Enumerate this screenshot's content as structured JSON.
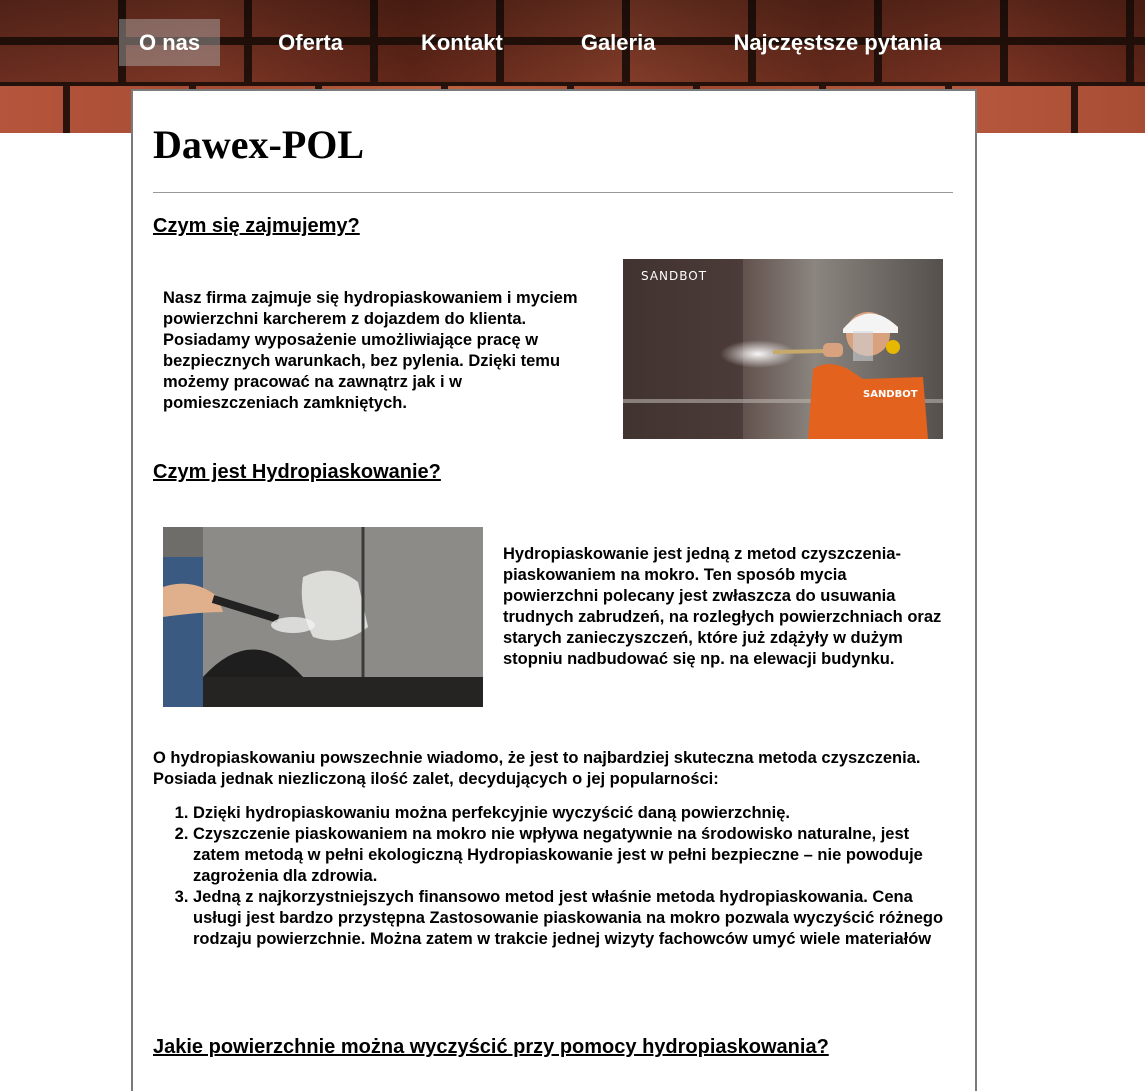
{
  "nav": {
    "items": [
      {
        "label": "O nas",
        "active": true
      },
      {
        "label": "Oferta",
        "active": false
      },
      {
        "label": "Kontakt",
        "active": false
      },
      {
        "label": "Galeria",
        "active": false
      },
      {
        "label": "Najczęstsze pytania",
        "active": false
      }
    ]
  },
  "main": {
    "title": "Dawex-POL",
    "section1": {
      "heading": "Czym się zajmujemy?",
      "text": "Nasz firma zajmuje się hydropiaskowaniem i myciem powierzchni karcherem z dojazdem do klienta. Posiadamy wyposażenie umożliwiające pracę w bezpiecznych warunkach, bez pylenia. Dzięki temu możemy pracować na zawnątrz jak i w pomieszczeniach zamkniętych.",
      "image_brand": "SANDBOT",
      "image_suit_label": "SANDBOT"
    },
    "section2": {
      "heading": "Czym jest Hydropiaskowanie?",
      "text": "Hydropiaskowanie jest jedną z metod czyszczenia-piaskowaniem na mokro. Ten sposób mycia powierzchni polecany jest zwłaszcza do usuwania trudnych zabrudzeń, na rozległych powierzchniach oraz starych zanieczyszczeń, które już zdążyły w dużym stopniu nadbudować się np. na elewacji budynku."
    },
    "section3": {
      "intro": "O hydropiaskowaniu powszechnie wiadomo, że jest to najbardziej skuteczna metoda czyszczenia. Posiada jednak niezliczoną ilość zalet, decydujących o jej popularności:",
      "advantages": [
        "Dzięki hydropiaskowaniu można perfekcyjnie wyczyścić daną powierzchnię.",
        "Czyszczenie piaskowaniem na mokro nie wpływa negatywnie na środowisko naturalne, jest zatem metodą w pełni ekologiczną Hydropiaskowanie jest w pełni bezpieczne – nie powoduje zagrożenia dla zdrowia.",
        "Jedną z najkorzystniejszych finansowo metod jest właśnie metoda hydropiaskowania. Cena usługi jest bardzo przystępna Zastosowanie piaskowania na mokro pozwala wyczyścić różnego rodzaju powierzchnie. Można zatem w trakcie jednej wizyty fachowców umyć wiele materiałów"
      ]
    },
    "section4": {
      "heading": "Jakie powierzchnie można wyczyścić przy pomocy hydropiaskowania?"
    }
  }
}
